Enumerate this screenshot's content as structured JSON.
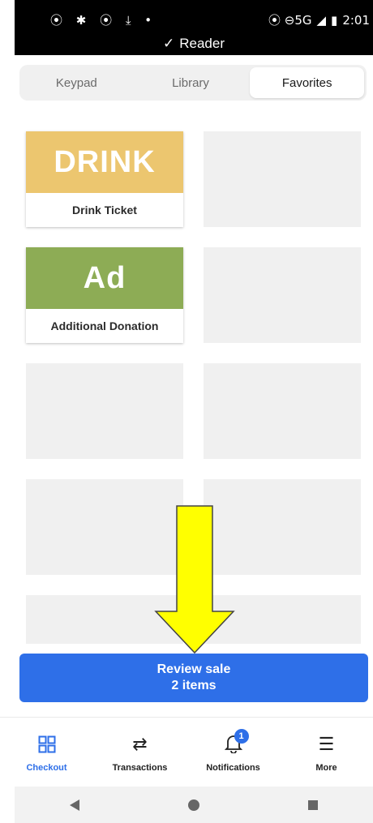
{
  "status": {
    "left_icons": "⦿ ✱ ⦿ ⤓ •",
    "right_icons": "⦿ ⊖5G",
    "time": "2:01"
  },
  "reader": {
    "label": "Reader"
  },
  "tabs": [
    {
      "label": "Keypad"
    },
    {
      "label": "Library"
    },
    {
      "label": "Favorites"
    }
  ],
  "favorites": [
    {
      "label": "Drink Ticket",
      "abbrev": "DRINK",
      "color": "#ecc66f"
    },
    {
      "label": "Additional Donation",
      "abbrev": "Ad",
      "color": "#8dac55"
    }
  ],
  "review": {
    "title": "Review sale",
    "count": "2 items"
  },
  "nav": [
    {
      "label": "Checkout"
    },
    {
      "label": "Transactions"
    },
    {
      "label": "Notifications",
      "badge": "1"
    },
    {
      "label": "More"
    }
  ],
  "colors": {
    "accent": "#2e6fe8",
    "arrow": "#ffff00"
  }
}
